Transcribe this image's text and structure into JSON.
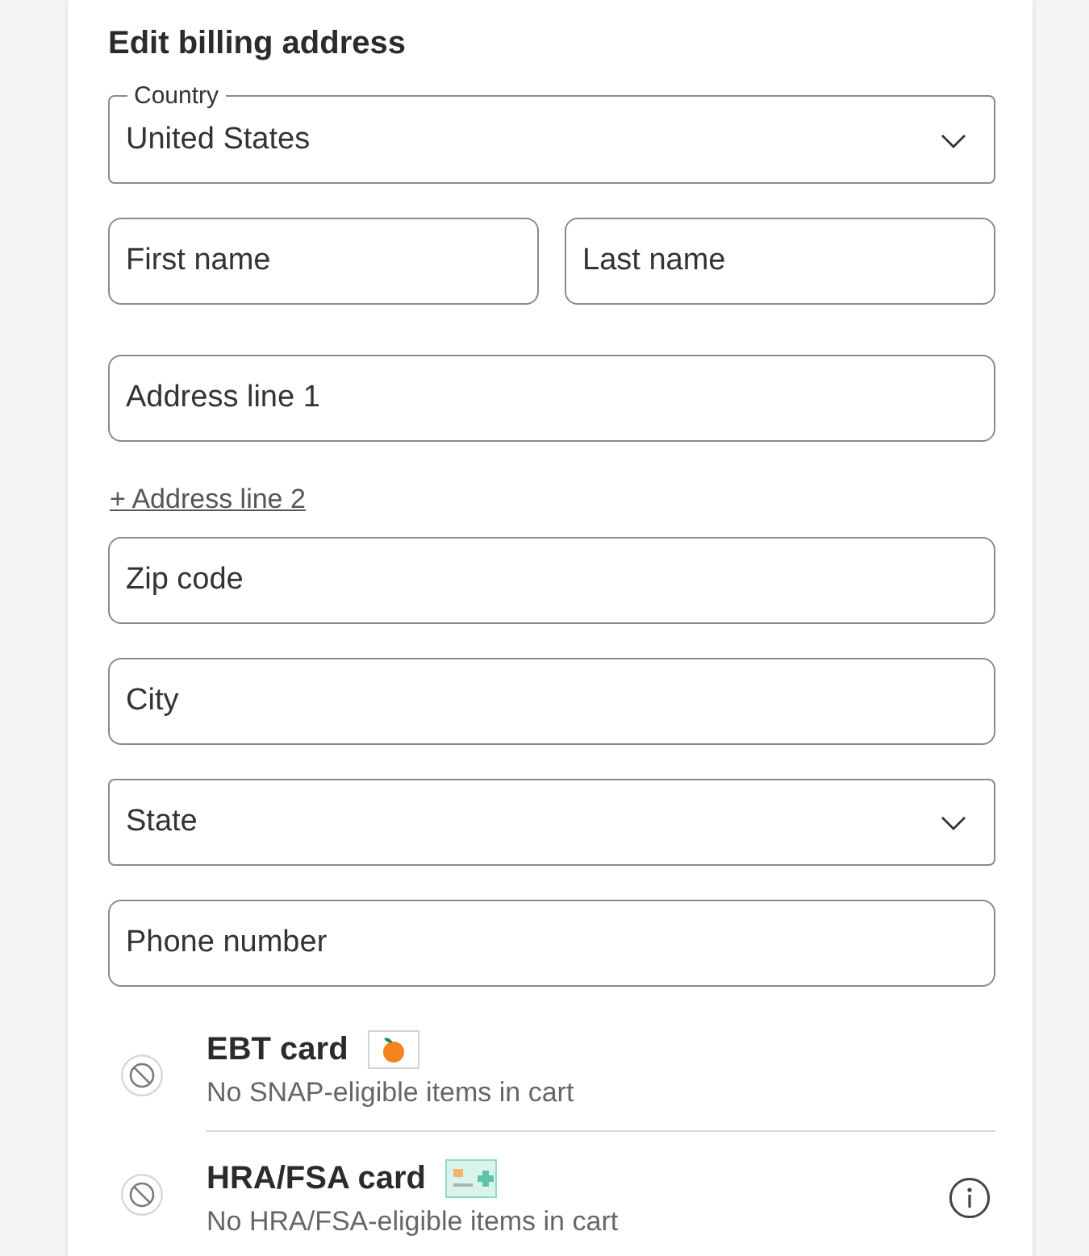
{
  "form": {
    "title": "Edit billing address",
    "fields": [
      {
        "kind": "select",
        "label": "Country",
        "value": "United States"
      },
      {
        "kind": "pair",
        "items": [
          {
            "kind": "text",
            "placeholder": "First name"
          },
          {
            "kind": "text",
            "placeholder": "Last name"
          }
        ]
      },
      {
        "kind": "text",
        "placeholder": "Address line 1"
      },
      {
        "kind": "link",
        "text": "+ Address line 2"
      },
      {
        "kind": "text",
        "placeholder": "Zip code"
      },
      {
        "kind": "text",
        "placeholder": "City"
      },
      {
        "kind": "select",
        "placeholder": "State"
      },
      {
        "kind": "text",
        "placeholder": "Phone number"
      }
    ]
  },
  "payment_options": [
    {
      "kind": "ebt",
      "title": "EBT card",
      "note": "No SNAP-eligible items in cart",
      "disabled": true,
      "info": false
    },
    {
      "kind": "fsa",
      "title": "HRA/FSA card",
      "note": "No HRA/FSA-eligible items in cart",
      "disabled": true,
      "info": true
    }
  ]
}
